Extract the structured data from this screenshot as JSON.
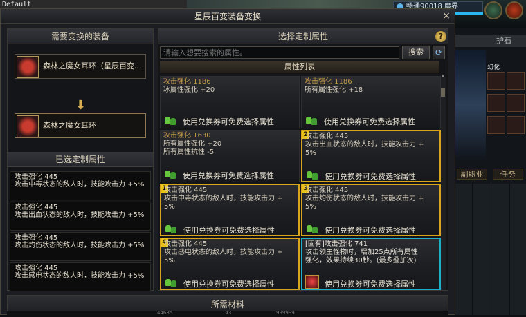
{
  "bg": {
    "app_label": "Default",
    "channel": "畅通90018 魔界",
    "right_tab": "护石",
    "right_label1": "副职业",
    "right_label2": "任务",
    "char_label": "幻化"
  },
  "window": {
    "title": "星辰百变装备变换",
    "close": "×"
  },
  "left_panel": {
    "header": "需要变换的装备",
    "source_item": "森林之魔女耳环（星辰百变...",
    "arrow": "⬇",
    "target_item": "森林之魔女耳环",
    "selected_header": "已选定制属性",
    "selected": [
      "攻击强化 445\n攻击中毒状态的敌人时，技能攻击力 +5%",
      "攻击强化 445\n攻击出血状态的敌人时，技能攻击力 +5%",
      "攻击强化 445\n攻击灼伤状态的敌人时，技能攻击力 +5%",
      "攻击强化 445\n攻击感电状态的敌人时，技能攻击力 +5%"
    ]
  },
  "right_panel": {
    "header": "选择定制属性",
    "help": "?",
    "search_placeholder": "请输入想要搜索的属性。",
    "search_button": "搜索",
    "refresh": "⟳",
    "list_header": "属性列表",
    "coupon_text": "使用兑换券可免费选择属性",
    "cards": [
      {
        "num": "",
        "l1": "攻击强化 1186",
        "l2": "冰属性强化 +20",
        "l3": ""
      },
      {
        "num": "",
        "l1": "攻击强化 1186",
        "l2": "所有属性强化 +18",
        "l3": ""
      },
      {
        "num": "",
        "l1": "攻击强化 1630",
        "l2": "所有属性强化 +20",
        "l3": "所有属性抗性 -5"
      },
      {
        "num": "2",
        "l1": "攻击强化 445",
        "l2": "攻击出血状态的敌人时，技能攻击力 +",
        "l3": "5%"
      },
      {
        "num": "1",
        "l1": "攻击强化 445",
        "l2": "攻击中毒状态的敌人时，技能攻击力 +",
        "l3": "5%"
      },
      {
        "num": "3",
        "l1": "攻击强化 445",
        "l2": "攻击灼伤状态的敌人时，技能攻击力 +",
        "l3": "5%"
      },
      {
        "num": "4",
        "l1": "攻击强化 445",
        "l2": "攻击感电状态的敌人时，技能攻击力 +",
        "l3": "5%"
      },
      {
        "num": "",
        "l1": "[固有]攻击强化 741",
        "l2": "攻击领主怪物时，增加25点所有属性",
        "l3": "强化，效果持续30秒。(最多叠加次)"
      }
    ]
  },
  "materials": {
    "header": "所需材料",
    "m1": "44685",
    "m2": "143",
    "m3": "999999"
  }
}
